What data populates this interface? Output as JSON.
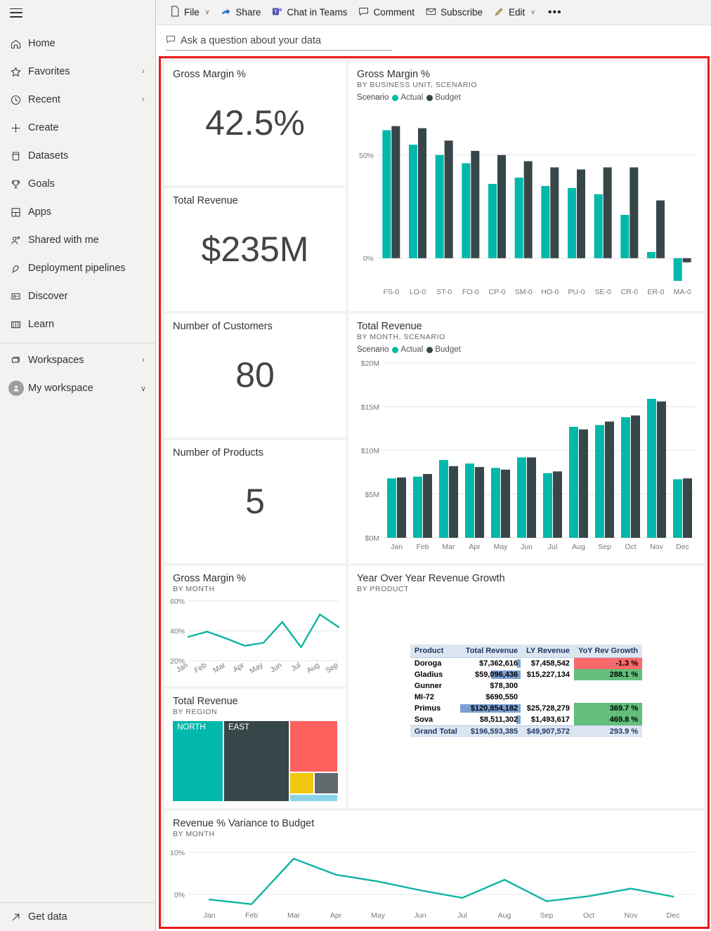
{
  "sidebar": {
    "hamburger_name": "hamburger-menu",
    "items": [
      {
        "label": "Home",
        "icon": "home-icon",
        "chevron": ""
      },
      {
        "label": "Favorites",
        "icon": "star-icon",
        "chevron": "›"
      },
      {
        "label": "Recent",
        "icon": "clock-icon",
        "chevron": "›"
      },
      {
        "label": "Create",
        "icon": "plus-icon",
        "chevron": ""
      },
      {
        "label": "Datasets",
        "icon": "database-icon",
        "chevron": ""
      },
      {
        "label": "Goals",
        "icon": "trophy-icon",
        "chevron": ""
      },
      {
        "label": "Apps",
        "icon": "apps-grid-icon",
        "chevron": ""
      },
      {
        "label": "Shared with me",
        "icon": "people-icon",
        "chevron": ""
      },
      {
        "label": "Deployment pipelines",
        "icon": "rocket-icon",
        "chevron": ""
      },
      {
        "label": "Discover",
        "icon": "discover-icon",
        "chevron": ""
      },
      {
        "label": "Learn",
        "icon": "book-icon",
        "chevron": ""
      }
    ],
    "workspaces": {
      "label": "Workspaces",
      "icon": "workspaces-icon",
      "chevron": "›"
    },
    "my_workspace": {
      "label": "My workspace",
      "icon": "avatar-icon",
      "chevron": "∨"
    },
    "get_data": {
      "label": "Get data",
      "icon": "arrow-up-right-icon"
    }
  },
  "toolbar": {
    "file": "File",
    "share": "Share",
    "chat_in_teams": "Chat in Teams",
    "comment": "Comment",
    "subscribe": "Subscribe",
    "edit": "Edit",
    "more": "•••",
    "caret": "∨"
  },
  "qna": {
    "placeholder": "Ask a question about your data"
  },
  "colors": {
    "actual": "#01b8aa",
    "budget": "#374649",
    "line": "#10b3a3",
    "highlight_border": "#e8191b",
    "treemap_red": "#fd625e",
    "treemap_yellow": "#f2c80f",
    "treemap_gray": "#5f6b6d",
    "treemap_blue": "#8ad4eb",
    "databar": "#7ba0d4",
    "positive": "#63be7b",
    "negative": "#f8696b"
  },
  "kpis": [
    {
      "title": "Gross Margin %",
      "value": "42.5%"
    },
    {
      "title": "Total Revenue",
      "value": "$235M"
    },
    {
      "title": "Number of Customers",
      "value": "80"
    },
    {
      "title": "Number of Products",
      "value": "5"
    }
  ],
  "tiles": {
    "gm_by_bu": {
      "title": "Gross Margin %",
      "subtitle": "BY BUSINESS UNIT, SCENARIO"
    },
    "rev_by_mo": {
      "title": "Total Revenue",
      "subtitle": "BY MONTH, SCENARIO"
    },
    "gm_by_mo": {
      "title": "Gross Margin %",
      "subtitle": "BY MONTH"
    },
    "rev_by_reg": {
      "title": "Total Revenue",
      "subtitle": "BY REGION"
    },
    "yoy": {
      "title": "Year Over Year Revenue Growth",
      "subtitle": "BY PRODUCT"
    },
    "variance": {
      "title": "Revenue % Variance to Budget",
      "subtitle": "BY MONTH"
    }
  },
  "legend": {
    "title": "Scenario",
    "actual": "Actual",
    "budget": "Budget"
  },
  "chart_data": [
    {
      "id": "gross-margin-by-business-unit",
      "type": "bar",
      "title": "Gross Margin %",
      "subtitle": "BY BUSINESS UNIT, SCENARIO",
      "xlabel": "",
      "ylabel": "",
      "ylim": [
        -12,
        70
      ],
      "yticks": [
        0,
        50
      ],
      "ytick_labels": [
        "0%",
        "50%"
      ],
      "grid": true,
      "legend_position": "top",
      "categories": [
        "FS-0",
        "LO-0",
        "ST-0",
        "FO-0",
        "CP-0",
        "SM-0",
        "HO-0",
        "PU-0",
        "SE-0",
        "CR-0",
        "ER-0",
        "MA-0"
      ],
      "series": [
        {
          "name": "Actual",
          "color": "#01b8aa",
          "values": [
            62,
            55,
            50,
            46,
            36,
            39,
            35,
            34,
            31,
            21,
            3,
            -11
          ]
        },
        {
          "name": "Budget",
          "color": "#374649",
          "values": [
            64,
            63,
            57,
            52,
            50,
            47,
            44,
            43,
            44,
            44,
            28,
            -2
          ]
        }
      ]
    },
    {
      "id": "total-revenue-by-month",
      "type": "bar",
      "title": "Total Revenue",
      "subtitle": "BY MONTH, SCENARIO",
      "xlabel": "",
      "ylabel": "",
      "ylim": [
        0,
        20
      ],
      "yticks": [
        0,
        5,
        10,
        15,
        20
      ],
      "ytick_labels": [
        "$0M",
        "$5M",
        "$10M",
        "$15M",
        "$20M"
      ],
      "grid": true,
      "legend_position": "top",
      "categories": [
        "Jan",
        "Feb",
        "Mar",
        "Apr",
        "May",
        "Jun",
        "Jul",
        "Aug",
        "Sep",
        "Oct",
        "Nov",
        "Dec"
      ],
      "series": [
        {
          "name": "Actual",
          "color": "#01b8aa",
          "values": [
            6.8,
            7.0,
            8.9,
            8.5,
            8.0,
            9.2,
            7.4,
            12.7,
            12.9,
            13.8,
            15.9,
            6.7
          ]
        },
        {
          "name": "Budget",
          "color": "#374649",
          "values": [
            6.9,
            7.3,
            8.2,
            8.1,
            7.8,
            9.2,
            7.6,
            12.4,
            13.3,
            14.0,
            15.6,
            6.8
          ]
        }
      ]
    },
    {
      "id": "gross-margin-by-month",
      "type": "line",
      "title": "Gross Margin %",
      "subtitle": "BY MONTH",
      "xlabel": "",
      "ylabel": "",
      "ylim": [
        20,
        60
      ],
      "yticks": [
        20,
        40,
        60
      ],
      "ytick_labels": [
        "20%",
        "40%",
        "60%"
      ],
      "grid": true,
      "categories": [
        "Jan",
        "Feb",
        "Mar",
        "Apr",
        "May",
        "Jun",
        "Jul",
        "Aug",
        "Sep"
      ],
      "values": [
        36,
        39.5,
        35,
        30,
        32,
        46,
        29,
        51,
        42.5
      ],
      "color": "#10b3a3"
    },
    {
      "id": "total-revenue-by-region",
      "type": "treemap",
      "title": "Total Revenue",
      "subtitle": "BY REGION",
      "slices": [
        {
          "label": "NORTH",
          "color": "#01b8aa",
          "share": 0.4
        },
        {
          "label": "EAST",
          "color": "#374649",
          "share": 0.42
        },
        {
          "label": "",
          "color": "#fd625e",
          "share": 0.11
        },
        {
          "label": "",
          "color": "#f2c80f",
          "share": 0.03
        },
        {
          "label": "",
          "color": "#5f6b6d",
          "share": 0.03
        },
        {
          "label": "",
          "color": "#8ad4eb",
          "share": 0.01
        }
      ]
    },
    {
      "id": "revenue-pct-variance-to-budget",
      "type": "line",
      "title": "Revenue % Variance to Budget",
      "subtitle": "BY MONTH",
      "xlabel": "",
      "ylabel": "",
      "ylim": [
        -3,
        10.5
      ],
      "yticks": [
        0,
        10
      ],
      "ytick_labels": [
        "0%",
        "10%"
      ],
      "grid": true,
      "categories": [
        "Jan",
        "Feb",
        "Mar",
        "Apr",
        "May",
        "Jun",
        "Jul",
        "Aug",
        "Sep",
        "Oct",
        "Nov",
        "Dec"
      ],
      "values": [
        -1.2,
        -2.3,
        8.5,
        4.7,
        3.1,
        1.0,
        -0.8,
        3.5,
        -1.6,
        -0.4,
        1.4,
        -0.5
      ],
      "color": "#10b3a3"
    },
    {
      "id": "year-over-year-revenue-growth",
      "type": "table",
      "title": "Year Over Year Revenue Growth",
      "subtitle": "BY PRODUCT",
      "columns": [
        "Product",
        "Total Revenue",
        "LY Revenue",
        "YoY Rev Growth"
      ],
      "rows": [
        {
          "product": "Doroga",
          "total_revenue": "$7,362,616",
          "ly_revenue": "$7,458,542",
          "yoy": "-1.3 %",
          "bar": 0.06,
          "yoy_color": "#f8696b"
        },
        {
          "product": "Gladius",
          "total_revenue": "$59,096,436",
          "ly_revenue": "$15,227,134",
          "yoy": "288.1 %",
          "bar": 0.49,
          "yoy_color": "#63be7b"
        },
        {
          "product": "Gunner",
          "total_revenue": "$78,300",
          "ly_revenue": "",
          "yoy": "",
          "bar": 0.0,
          "yoy_color": ""
        },
        {
          "product": "MI-72",
          "total_revenue": "$690,550",
          "ly_revenue": "",
          "yoy": "",
          "bar": 0.0,
          "yoy_color": ""
        },
        {
          "product": "Primus",
          "total_revenue": "$120,854,182",
          "ly_revenue": "$25,728,279",
          "yoy": "369.7 %",
          "bar": 1.0,
          "yoy_color": "#63be7b"
        },
        {
          "product": "Sova",
          "total_revenue": "$8,511,302",
          "ly_revenue": "$1,493,617",
          "yoy": "469.8 %",
          "bar": 0.07,
          "yoy_color": "#63be7b"
        }
      ],
      "grand_total": {
        "product": "Grand Total",
        "total_revenue": "$196,593,385",
        "ly_revenue": "$49,907,572",
        "yoy": "293.9 %"
      }
    }
  ]
}
